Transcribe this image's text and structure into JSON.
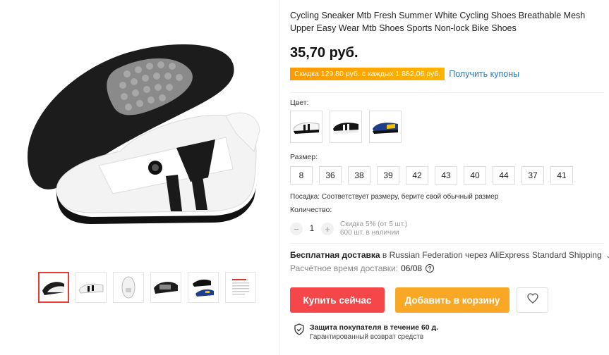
{
  "product": {
    "title": "Cycling Sneaker Mtb Fresh Summer White Cycling Shoes Breathable Mesh Upper Easy Wear Mtb Shoes Sports Non-lock Bike Shoes",
    "price": "35,70 руб.",
    "promo": "Скидка 129,80 руб. с каждых 1 882,06 руб.",
    "coupon_link": "Получить купоны"
  },
  "color": {
    "label": "Цвет:",
    "options": [
      "white-black",
      "black-white",
      "blue-yellow"
    ]
  },
  "size": {
    "label": "Размер:",
    "options": [
      "8",
      "36",
      "38",
      "39",
      "42",
      "43",
      "40",
      "44",
      "37",
      "41"
    ]
  },
  "fit_note": "Посадка: Соответствует размеру, берите свой обычный размер",
  "quantity": {
    "label": "Количество:",
    "minus": "−",
    "value": "1",
    "plus": "+",
    "discount": "Скидка 5% (от 5 шт.)",
    "stock": "600 шт. в наличии"
  },
  "shipping": {
    "free": "Бесплатная доставка",
    "route": " в Russian Federation через AliExpress Standard Shipping",
    "chevron": "⌄",
    "eta_label": "Расчётное время доставки:",
    "eta_date": "06/08",
    "help": "?"
  },
  "actions": {
    "buy_now": "Купить сейчас",
    "add_to_cart": "Добавить в корзину"
  },
  "protection": {
    "title": "Защита покупателя в течение 60 д.",
    "subtitle": "Гарантированный возврат средств"
  },
  "colors": {
    "buy": "#f5474a",
    "cart": "#f9a826",
    "promo": "#ff9a00",
    "link": "#2b7bb9",
    "active_thumb": "#e53935"
  }
}
